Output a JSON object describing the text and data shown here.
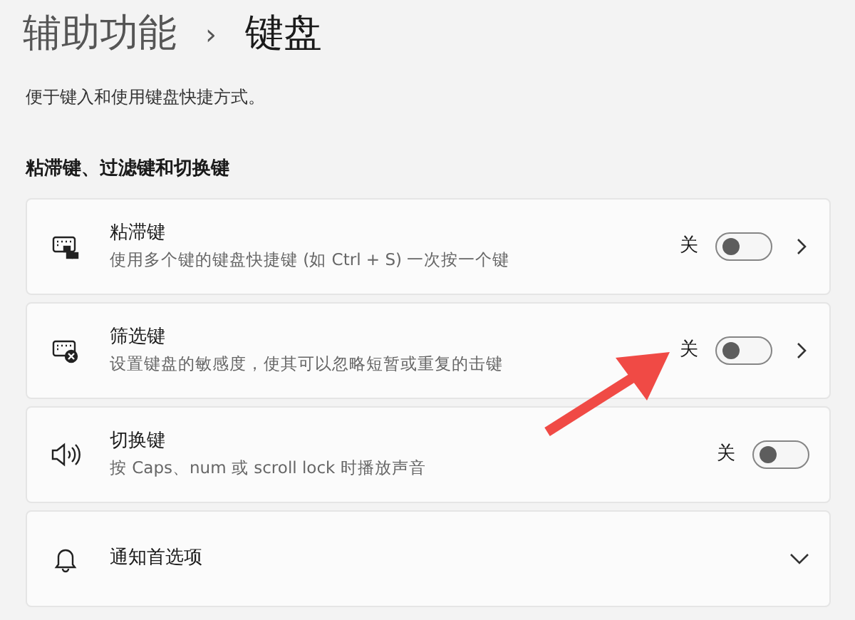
{
  "breadcrumb": {
    "parent": "辅助功能",
    "separator": "›",
    "current": "键盘"
  },
  "description": "便于键入和使用键盘快捷方式。",
  "section_title": "粘滞键、过滤键和切换键",
  "settings": [
    {
      "kind": "toggle-link",
      "title": "粘滞键",
      "subtitle": "使用多个键的键盘快捷键 (如 Ctrl + S) 一次按一个键",
      "state_label": "关",
      "on": false
    },
    {
      "kind": "toggle-link",
      "title": "筛选键",
      "subtitle": "设置键盘的敏感度，使其可以忽略短暂或重复的击键",
      "state_label": "关",
      "on": false
    },
    {
      "kind": "toggle",
      "title": "切换键",
      "subtitle": "按 Caps、num 或 scroll lock 时播放声音",
      "state_label": "关",
      "on": false
    },
    {
      "kind": "expander",
      "title": "通知首选项",
      "expanded": false
    }
  ],
  "annotations": [
    {
      "kind": "arrow",
      "color": "#f04a45"
    }
  ]
}
